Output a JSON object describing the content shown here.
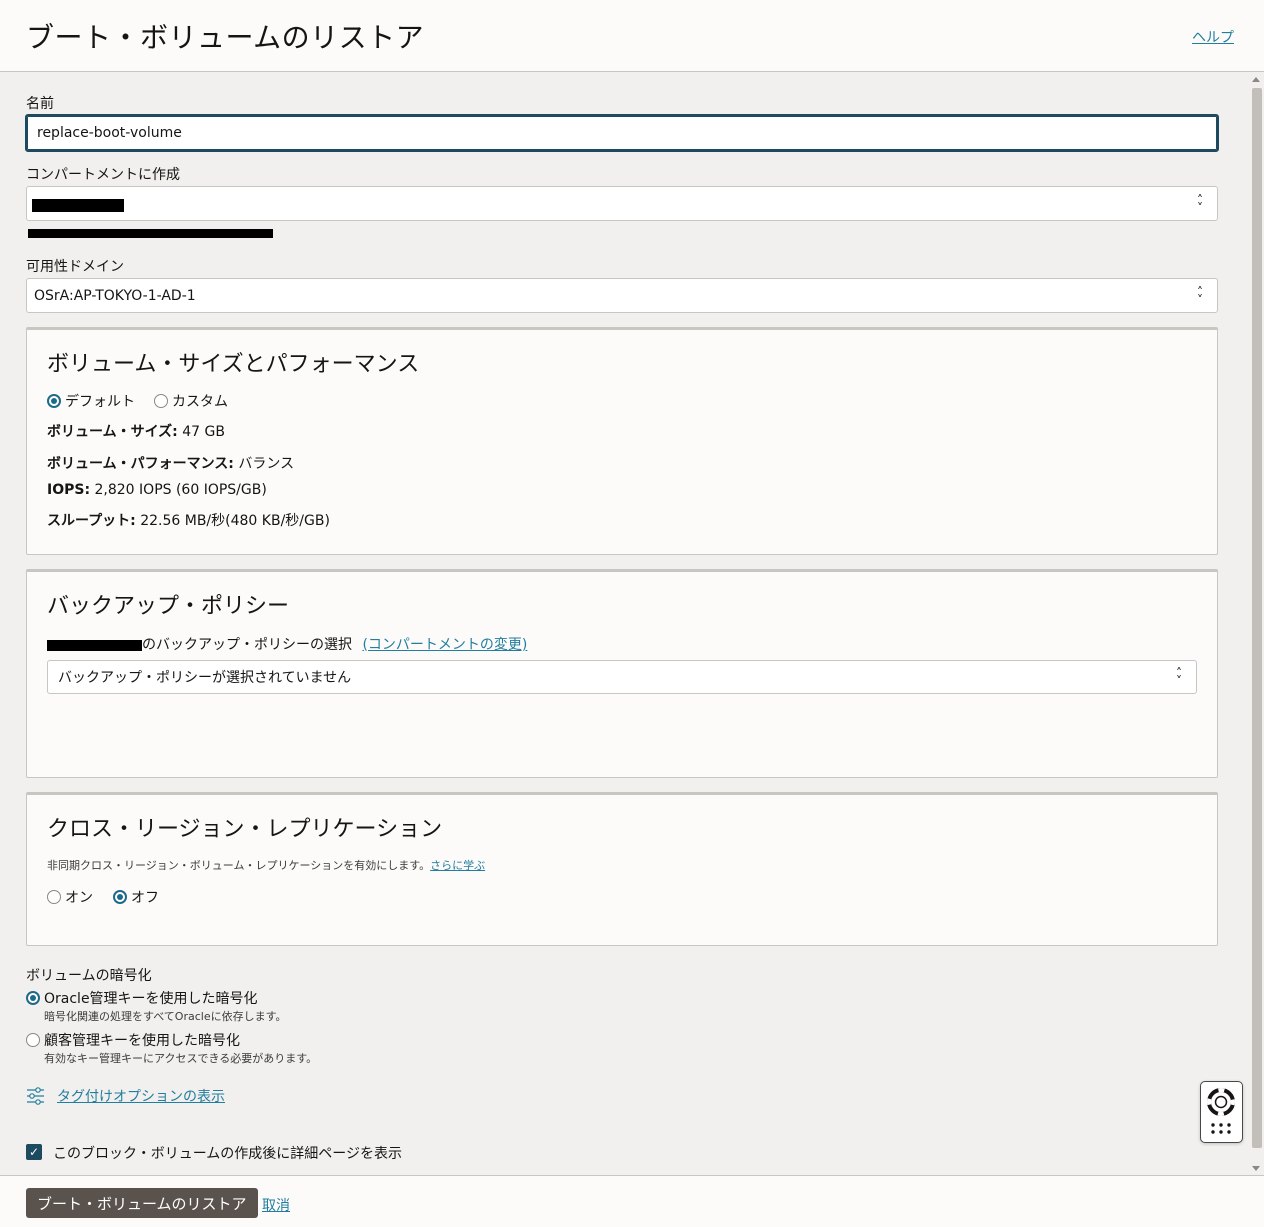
{
  "header": {
    "title": "ブート・ボリュームのリストア",
    "help_label": "ヘルプ"
  },
  "form": {
    "name_label": "名前",
    "name_value": "replace-boot-volume",
    "compartment_label": "コンパートメントに作成",
    "ad_label": "可用性ドメイン",
    "ad_value": "OSrA:AP-TOKYO-1-AD-1"
  },
  "volume_card": {
    "title": "ボリューム・サイズとパフォーマンス",
    "option_default": "デフォルト",
    "option_custom": "カスタム",
    "size_key": "ボリューム・サイズ:",
    "size_value": " 47 GB",
    "perf_key": "ボリューム・パフォーマンス:",
    "perf_value": " バランス",
    "iops_key": "IOPS:",
    "iops_value": " 2,820 IOPS (60 IOPS/GB)",
    "throughput_key": "スループット:",
    "throughput_value": " 22.56 MB/秒(480 KB/秒/GB)"
  },
  "backup_card": {
    "title": "バックアップ・ポリシー",
    "select_prefix": "のバックアップ・ポリシーの選択",
    "change_link": "(コンパートメントの変更)",
    "select_value": "バックアップ・ポリシーが選択されていません"
  },
  "replication_card": {
    "title": "クロス・リージョン・レプリケーション",
    "description": "非同期クロス・リージョン・ボリューム・レプリケーションを有効にします。",
    "learn_more": "さらに学ぶ",
    "option_on": "オン",
    "option_off": "オフ"
  },
  "encryption": {
    "label": "ボリュームの暗号化",
    "oracle_option": "Oracle管理キーを使用した暗号化",
    "oracle_desc": "暗号化関連の処理をすべてOracleに依存します。",
    "customer_option": "顧客管理キーを使用した暗号化",
    "customer_desc": "有効なキー管理キーにアクセスできる必要があります。"
  },
  "tags_link": "タグ付けオプションの表示",
  "show_details_label": "このブロック・ボリュームの作成後に詳細ページを表示",
  "footer": {
    "submit_label": "ブート・ボリュームのリストア",
    "cancel_label": "取消"
  },
  "colors": {
    "accent": "#227e9e",
    "primary_button": "#5a534d",
    "selected": "#1d6a8a"
  }
}
